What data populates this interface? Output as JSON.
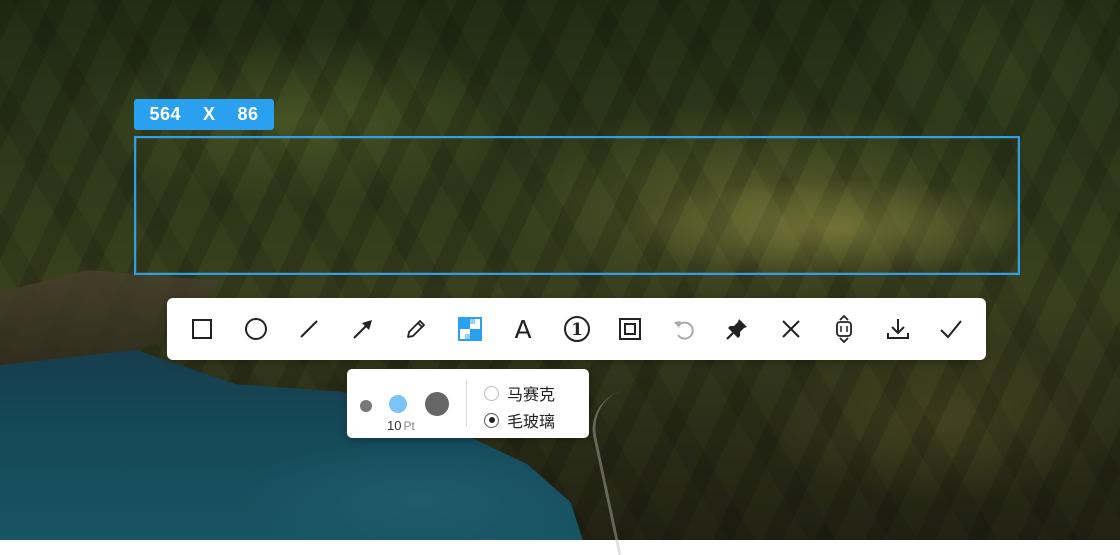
{
  "selection": {
    "width": "564",
    "separator": "X",
    "height": "86"
  },
  "toolbar": {
    "tools": [
      "rectangle-icon",
      "ellipse-icon",
      "line-icon",
      "arrow-icon",
      "pencil-icon",
      "mosaic-icon",
      "text-icon",
      "number-marker-icon",
      "border-icon",
      "undo-icon",
      "pin-icon",
      "close-icon",
      "long-screenshot-icon",
      "download-icon",
      "confirm-icon"
    ],
    "active_tool": "mosaic-icon",
    "text_glyph": "A",
    "number_glyph": "①",
    "accent_color": "#2aa0f0"
  },
  "subpanel": {
    "brush_sizes": [
      "small",
      "medium",
      "large"
    ],
    "selected_size": "medium",
    "size_value": "10",
    "size_unit": "Pt",
    "options": [
      {
        "label": "马赛克",
        "checked": false
      },
      {
        "label": "毛玻璃",
        "checked": true
      }
    ]
  }
}
